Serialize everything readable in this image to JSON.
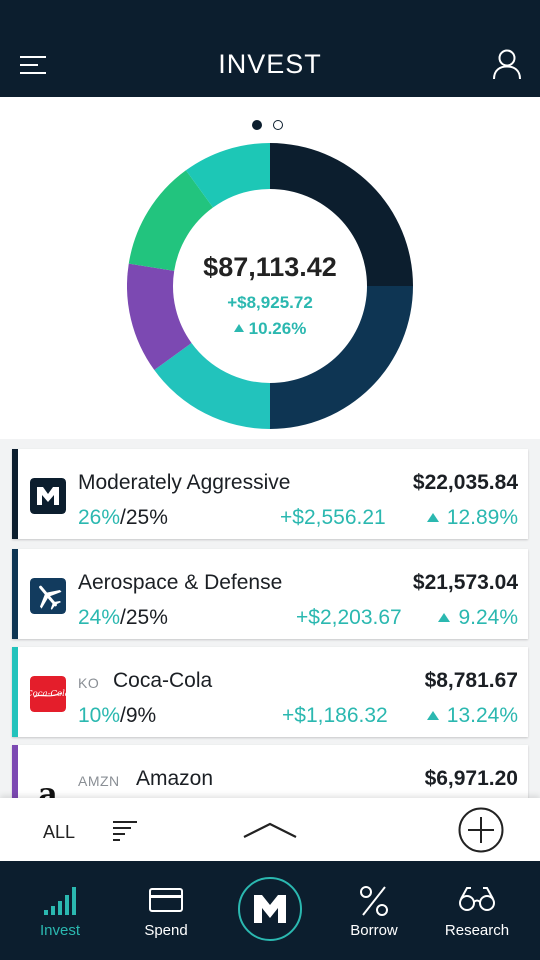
{
  "header": {
    "title": "INVEST",
    "menu_icon": "menu-icon",
    "profile_icon": "user-icon"
  },
  "portfolio": {
    "total": "$87,113.42",
    "gain": "+$8,925.72",
    "gain_pct": "10.26%",
    "page_indicator": {
      "count": 2,
      "active": 0
    },
    "allocation": [
      {
        "color": "#0c1e2e",
        "share": 0.25
      },
      {
        "color": "#0e3553",
        "share": 0.25
      },
      {
        "color": "#22c3bc",
        "share": 0.15
      },
      {
        "color": "#7c49b2",
        "share": 0.125
      },
      {
        "color": "#22c47e",
        "share": 0.125
      },
      {
        "color": "#1dc7b6",
        "share": 0.1
      }
    ]
  },
  "holdings": [
    {
      "ticker": "",
      "name": "Moderately Aggressive",
      "value": "$22,035.84",
      "current": "26%",
      "target": "/25%",
      "change": "+$2,556.21",
      "pct": "12.89%",
      "accent": "#0c1e2e",
      "icon": "m1-portfolio-icon"
    },
    {
      "ticker": "",
      "name": "Aerospace & Defense",
      "value": "$21,573.04",
      "current": "24%",
      "target": "/25%",
      "change": "+$2,203.67",
      "pct": "9.24%",
      "accent": "#0e3553",
      "icon": "airplane-icon"
    },
    {
      "ticker": "KO",
      "name": "Coca-Cola",
      "value": "$8,781.67",
      "current": "10%",
      "target": "/9%",
      "change": "+$1,186.32",
      "pct": "13.24%",
      "accent": "#22c3bc",
      "icon": "coca-cola-logo"
    },
    {
      "ticker": "AMZN",
      "name": "Amazon",
      "value": "$6,971.20",
      "current": "",
      "target": "",
      "change": "",
      "pct": "",
      "accent": "#7c49b2",
      "icon": "amazon-logo"
    }
  ],
  "toolbar": {
    "filter_label": "ALL",
    "sort_icon": "sort-icon",
    "expand_icon": "chevron-up-icon",
    "add_icon": "add-circle-icon"
  },
  "tabs": [
    {
      "label": "Invest",
      "icon": "bar-chart-icon",
      "active": true
    },
    {
      "label": "Spend",
      "icon": "credit-card-icon",
      "active": false
    },
    {
      "label": "",
      "icon": "m1-logo-icon",
      "active": false
    },
    {
      "label": "Borrow",
      "icon": "percent-icon",
      "active": false
    },
    {
      "label": "Research",
      "icon": "glasses-icon",
      "active": false
    }
  ],
  "colors": {
    "navy": "#0c1e2e",
    "teal": "#2bb8b0",
    "background": "#f2f3f4"
  }
}
